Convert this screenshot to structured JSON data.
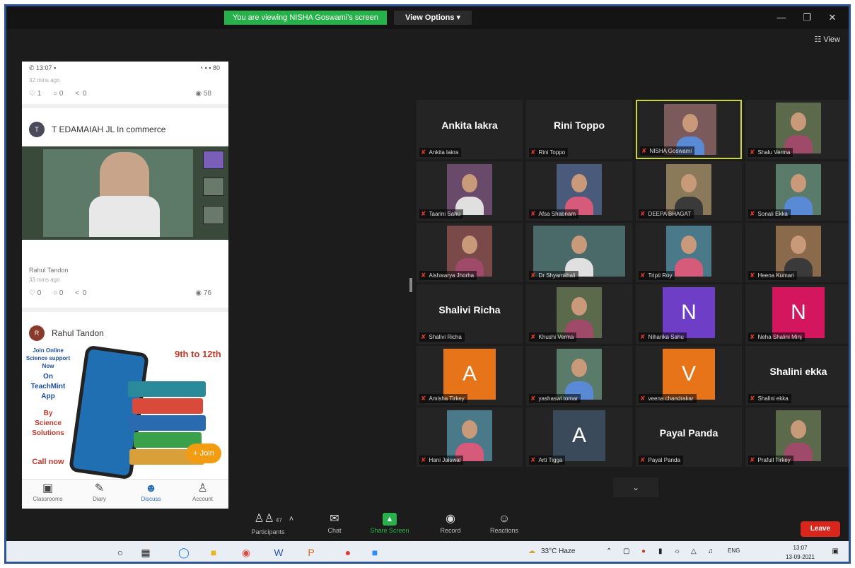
{
  "zoom_top": {
    "viewing_banner": "You are viewing NISHA Goswami's screen",
    "view_options_label": "View Options ▾",
    "minimize": "—",
    "restore": "❐",
    "close": "✕",
    "view_label": "☷ View"
  },
  "phone": {
    "status_time": "✆ 13:07 ▪",
    "status_right": "◔ ▪ ▪ 80",
    "post1": {
      "time": "32 mins ago",
      "likes": "♡ 1",
      "comments": "○ 0",
      "shares": "<  0",
      "views": "◉ 58"
    },
    "post2": {
      "avatar": "T",
      "author": "T EDAMAIAH JL In commerce",
      "caption": "Rahul Tandon",
      "time": "33 mins ago",
      "likes": "♡ 0",
      "comments": "○ 0",
      "shares": "<  0",
      "views": "◉ 76"
    },
    "post3": {
      "avatar": "R",
      "author": "Rahul Tandon",
      "grade_text": "9th to 12th",
      "line1": "Join Online",
      "line2": "Science support",
      "line3": "Now",
      "line4": "On",
      "line5": "TeachMint",
      "line6": "App",
      "line7": "By",
      "line8": "Science",
      "line9": "Solutions",
      "line10": "Call now",
      "join_label": "+ Join"
    },
    "nav": [
      {
        "icon": "▣",
        "label": "Classrooms"
      },
      {
        "icon": "✎",
        "label": "Diary"
      },
      {
        "icon": "☻",
        "label": "Discuss"
      },
      {
        "icon": "♙",
        "label": "Account"
      }
    ]
  },
  "participants": [
    {
      "name": "Ankita lakra",
      "label": "Ankita lakra",
      "type": "name"
    },
    {
      "name": "Rini Toppo",
      "label": "Rini Toppo",
      "type": "name"
    },
    {
      "name": "NISHA Goswami",
      "label": "NISHA Goswami",
      "type": "video"
    },
    {
      "name": "Shalu Verma",
      "label": "Shalu Verma",
      "type": "video"
    },
    {
      "name": "Taarini Sahu",
      "label": "Taarini Sahu",
      "type": "video"
    },
    {
      "name": "Afsa Shabnam",
      "label": "Afsa Shabnam",
      "type": "video"
    },
    {
      "name": "DEEPA BHAGAT",
      "label": "DEEPA BHAGAT",
      "type": "video"
    },
    {
      "name": "Sonali Ekka",
      "label": "Sonali Ekka",
      "type": "video"
    },
    {
      "name": "Aishwarya Jhorha",
      "label": "Aishwarya Jhorha",
      "type": "video"
    },
    {
      "name": "Dr Shyamkhali",
      "label": "Dr Shyamkhali",
      "type": "video"
    },
    {
      "name": "Tripti Roy",
      "label": "Tripti Roy",
      "type": "video"
    },
    {
      "name": "Heena Kumari",
      "label": "Heena Kumari",
      "type": "video"
    },
    {
      "name": "Shalivi Richa",
      "label": "Shalivi Richa",
      "type": "name"
    },
    {
      "name": "Khushi Verma",
      "label": "Khushi Verma",
      "type": "video"
    },
    {
      "name": "Niharika Sahu",
      "label": "Niharika Sahu",
      "type": "letter",
      "letter": "N",
      "color": "#6e3fc6"
    },
    {
      "name": "Neha Shalini Minj",
      "label": "Neha Shalini Minj",
      "type": "letter",
      "letter": "N",
      "color": "#d4165e"
    },
    {
      "name": "Amisha Tirkey",
      "label": "Amisha Tirkey",
      "type": "letter",
      "letter": "A",
      "color": "#e8741a"
    },
    {
      "name": "yashaswi tomar",
      "label": "yashaswi tomar",
      "type": "video"
    },
    {
      "name": "veena chandrakar",
      "label": "veena chandrakar",
      "type": "letter",
      "letter": "V",
      "color": "#e8741a"
    },
    {
      "name": "Shalini ekka",
      "label": "Shalini ekka",
      "type": "name"
    },
    {
      "name": "Hani Jaiswal",
      "label": "Hani Jaiswal",
      "type": "video"
    },
    {
      "name": "Arti Tigga",
      "label": "Arti Tigga",
      "type": "letter",
      "letter": "A",
      "color": "#3a4a5a"
    },
    {
      "name": "Payal Panda",
      "label": "Payal Panda",
      "type": "name"
    },
    {
      "name": "Prafull Tirkey",
      "label": "Prafull Tirkey",
      "type": "video"
    }
  ],
  "toolbar": {
    "participants_label": "Participants",
    "participants_count": "47",
    "participants_caret": "˄",
    "chat_label": "Chat",
    "share_label": "Share Screen",
    "record_label": "Record",
    "reactions_label": "Reactions",
    "leave_label": "Leave",
    "more_chevron": "⌄"
  },
  "taskbar": {
    "weather": "33°C Haze",
    "lang": "ENG",
    "time": "13:07",
    "date": "13-09-2021"
  }
}
